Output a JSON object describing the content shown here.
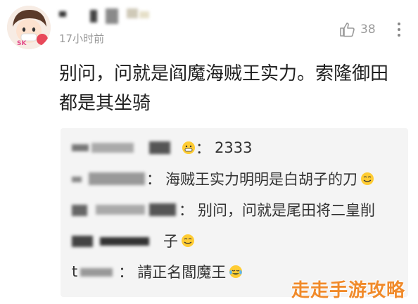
{
  "comment": {
    "timestamp": "17小时前",
    "like_count": "38",
    "text": "别问，问就是阎魔海贼王实力。索隆御田都是其坐骑"
  },
  "replies": [
    {
      "name_visible": "",
      "text": "2333",
      "emoji": "grinning-face-icon"
    },
    {
      "name_visible": "",
      "text": "海贼王实力明明是白胡子的刀",
      "emoji": "smiling-face-icon"
    },
    {
      "name_visible": "",
      "text": "别问，问就是尾田将二皇削",
      "emoji": ""
    },
    {
      "name_visible": "子",
      "text": "",
      "emoji": "smiling-face-icon"
    },
    {
      "name_visible": "t",
      "text": "請正名閻魔王",
      "emoji": "tears-of-joy-icon"
    }
  ],
  "watermark": "走走手游攻略",
  "colors": {
    "watermark": "#f08a2a",
    "reply_bg": "#f4f4f4",
    "muted": "#9a9a9a"
  }
}
